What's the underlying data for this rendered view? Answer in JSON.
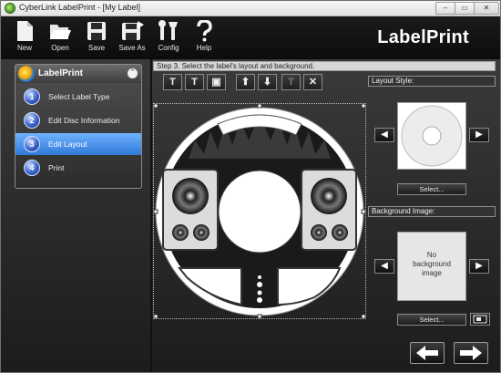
{
  "window": {
    "title": "CyberLink LabelPrint - [My Label]",
    "min_glyph": "–",
    "max_glyph": "▭",
    "close_glyph": "✕"
  },
  "toolbar": {
    "items": [
      {
        "label": "New",
        "icon": "new-file-icon"
      },
      {
        "label": "Open",
        "icon": "open-folder-icon"
      },
      {
        "label": "Save",
        "icon": "save-disk-icon"
      },
      {
        "label": "Save As",
        "icon": "save-as-icon"
      },
      {
        "label": "Config",
        "icon": "config-tools-icon"
      },
      {
        "label": "Help",
        "icon": "help-icon"
      }
    ],
    "brand": "LabelPrint"
  },
  "left_panel": {
    "title": "LabelPrint",
    "collapse_glyph": "⌃",
    "steps": [
      {
        "num": "1",
        "label": "Select Label Type"
      },
      {
        "num": "2",
        "label": "Edit Disc Information"
      },
      {
        "num": "3",
        "label": "Edit Layout"
      },
      {
        "num": "4",
        "label": "Print"
      }
    ],
    "active_step": 3
  },
  "center": {
    "step_heading": "Step 3. Select the label's layout and background.",
    "edit_tools": [
      {
        "glyph": "T",
        "icon": "add-text-icon"
      },
      {
        "glyph": "T",
        "icon": "add-curved-text-icon"
      },
      {
        "glyph": "▣",
        "icon": "add-image-icon"
      },
      {
        "glyph": "⬆",
        "icon": "bring-forward-icon"
      },
      {
        "glyph": "⬇",
        "icon": "send-backward-icon"
      },
      {
        "glyph": "T",
        "icon": "text-properties-icon"
      },
      {
        "glyph": "✕",
        "icon": "delete-icon"
      }
    ]
  },
  "right_panel": {
    "layout_style_heading": "Layout Style:",
    "layout_select_label": "Select...",
    "background_heading": "Background Image:",
    "background_placeholder": "No background image",
    "background_select_label": "Select...",
    "prev_glyph": "◀",
    "next_glyph": "▶"
  },
  "footer": {
    "back_icon": "back-arrow-icon",
    "next_icon": "next-arrow-icon"
  },
  "colors": {
    "accent_active_step": "#2f7ad8",
    "toolbar_bg": "#0c0c0c",
    "panel_bg": "#2a2a2a"
  }
}
